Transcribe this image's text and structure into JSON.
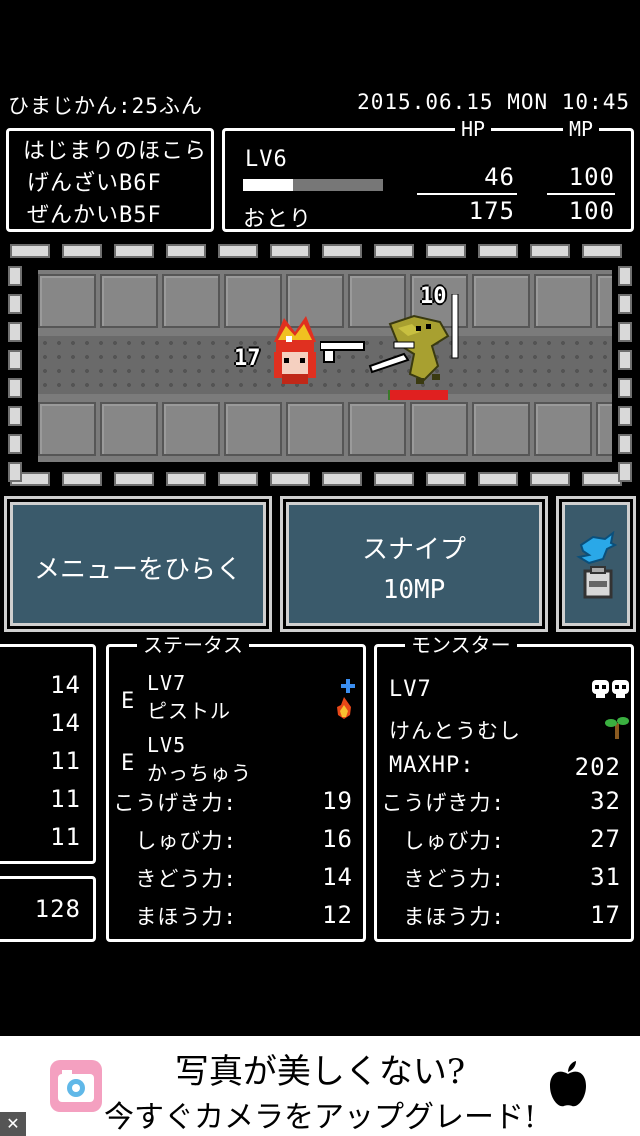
{
  "status_bar": {
    "playtime": "ひまじかん:25ふん",
    "datetime": "2015.06.15 MON 10:45"
  },
  "location": {
    "dungeon_name": "はじまりのほこら",
    "current_floor": "げんざいB6F",
    "best_floor": "ぜんかいB5F"
  },
  "player": {
    "level": "LV6",
    "status": "おとり",
    "hp_header": "HP",
    "mp_header": "MP",
    "hp_current": "46",
    "hp_max": "175",
    "mp_current": "100",
    "mp_max": "100",
    "exp_fraction": 0.36
  },
  "battle": {
    "player_damage_taken": "17",
    "enemy_damage_taken": "10",
    "enemy_hp_fraction": 0.96
  },
  "buttons": {
    "menu": "メニューをひらく",
    "skill_name": "スナイプ",
    "skill_cost": "10MP"
  },
  "left_stats": {
    "values": [
      "14",
      "14",
      "11",
      "11",
      "11"
    ],
    "gold": "128"
  },
  "status_panel": {
    "title": "ステータス",
    "equip_marker": "E",
    "weapon_level": "LV7",
    "weapon_name": "ピストル",
    "armor_level": "LV5",
    "armor_name": "かっちゅう",
    "stats": [
      {
        "label": "こうげき力:",
        "value": "19"
      },
      {
        "label": "しゅび力:",
        "value": "16"
      },
      {
        "label": "きどう力:",
        "value": "14"
      },
      {
        "label": "まほう力:",
        "value": "12"
      }
    ]
  },
  "monster_panel": {
    "title": "モンスター",
    "level": "LV7",
    "name": "けんとうむし",
    "maxhp_label": "MAXHP:",
    "maxhp_value": "202",
    "stats": [
      {
        "label": "こうげき力:",
        "value": "32"
      },
      {
        "label": "しゅび力:",
        "value": "27"
      },
      {
        "label": "きどう力:",
        "value": "31"
      },
      {
        "label": "まほう力:",
        "value": "17"
      }
    ]
  },
  "ad": {
    "headline": "写真が美しくない?",
    "subline": "今すぐカメラをアップグレード!",
    "close": "✕"
  },
  "colors": {
    "button_fill": "#3a5a6b",
    "exp_bar": "#ffffff",
    "enemy_hp_bar": "#e02020",
    "enemy_body": "#a8a030"
  }
}
